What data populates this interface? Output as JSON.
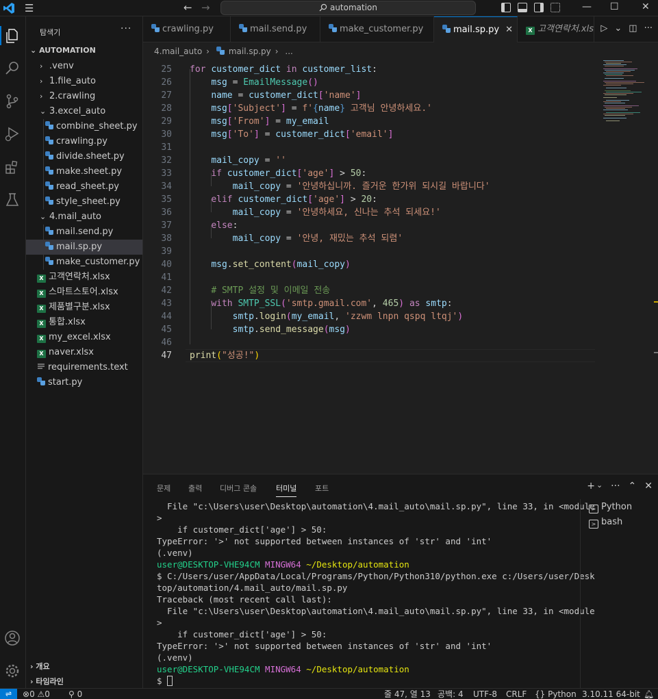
{
  "titlebar": {
    "search_text": "automation"
  },
  "sidebar": {
    "title": "탐색기",
    "root": "AUTOMATION",
    "items": [
      {
        "label": ".venv",
        "type": "folder",
        "open": false
      },
      {
        "label": "1.file_auto",
        "type": "folder",
        "open": false
      },
      {
        "label": "2.crawling",
        "type": "folder",
        "open": false
      },
      {
        "label": "3.excel_auto",
        "type": "folder",
        "open": true
      },
      {
        "label": "combine_sheet.py",
        "type": "py"
      },
      {
        "label": "crawling.py",
        "type": "py"
      },
      {
        "label": "divide.sheet.py",
        "type": "py"
      },
      {
        "label": "make.sheet.py",
        "type": "py"
      },
      {
        "label": "read_sheet.py",
        "type": "py"
      },
      {
        "label": "style_sheet.py",
        "type": "py"
      },
      {
        "label": "4.mail_auto",
        "type": "folder",
        "open": true
      },
      {
        "label": "mail.send.py",
        "type": "py"
      },
      {
        "label": "mail.sp.py",
        "type": "py"
      },
      {
        "label": "make_customer.py",
        "type": "py"
      },
      {
        "label": "고객연락처.xlsx",
        "type": "xlsx"
      },
      {
        "label": "스마트스토어.xlsx",
        "type": "xlsx"
      },
      {
        "label": "제품별구분.xlsx",
        "type": "xlsx"
      },
      {
        "label": "통합.xlsx",
        "type": "xlsx"
      },
      {
        "label": "my_excel.xlsx",
        "type": "xlsx"
      },
      {
        "label": "naver.xlsx",
        "type": "xlsx"
      },
      {
        "label": "requirements.text",
        "type": "txt"
      },
      {
        "label": "start.py",
        "type": "py"
      }
    ],
    "outline": "개요",
    "timeline": "타임라인"
  },
  "tabs": [
    {
      "label": "crawling.py"
    },
    {
      "label": "mail.send.py"
    },
    {
      "label": "make_customer.py"
    },
    {
      "label": "mail.sp.py"
    },
    {
      "label": "고객연락처.xlsx"
    }
  ],
  "breadcrumb": {
    "folder": "4.mail_auto",
    "file": "mail.sp.py",
    "more": "..."
  },
  "editor": {
    "line_numbers": [
      "25",
      "26",
      "27",
      "28",
      "29",
      "30",
      "31",
      "32",
      "33",
      "34",
      "35",
      "36",
      "37",
      "38",
      "39",
      "40",
      "41",
      "42",
      "43",
      "44",
      "45",
      "46",
      "47"
    ],
    "strings": {
      "s_name": "'name'",
      "s_subject": "'Subject'",
      "s_fstr_start": "f'",
      "s_fstr_end": " 고객님 안녕하세요.'",
      "s_from": "'From'",
      "s_to": "'To'",
      "s_email": "'email'",
      "s_empty": "''",
      "s_age": "'age'",
      "s_msg1": "'안녕하십니까. 즐거운 한가위 되시길 바랍니다'",
      "s_msg2": "'안녕하세요, 신나는 추석 되세요!'",
      "s_msg3": "'안녕, 재밌는 추석 되렴'",
      "s_comment": "# SMTP 설정 및 이메일 전송",
      "s_smtp": "'smtp.gmail.com'",
      "s_pass": "'zzwm lnpn qspq ltqj'",
      "s_success": "\"성공!\""
    },
    "numbers": {
      "n50": "50",
      "n20": "20",
      "n465": "465"
    }
  },
  "panel": {
    "tabs": [
      "문제",
      "출력",
      "디버그 콘솔",
      "터미널",
      "포트"
    ],
    "terminal_lines": [
      "  File \"c:\\Users\\user\\Desktop\\automation\\4.mail_auto\\mail.sp.py\", line 33, in <module",
      ">",
      "    if customer_dict['age'] > 50:",
      "TypeError: '>' not supported between instances of 'str' and 'int'",
      "(.venv)",
      "$ C:/Users/user/AppData/Local/Programs/Python/Python310/python.exe c:/Users/user/Desk",
      "top/automation/4.mail_auto/mail.sp.py",
      "Traceback (most recent call last):",
      "  File \"c:\\Users\\user\\Desktop\\automation\\4.mail_auto\\mail.sp.py\", line 33, in <module",
      ">",
      "    if customer_dict['age'] > 50:",
      "TypeError: '>' not supported between instances of 'str' and 'int'",
      "(.venv)",
      "$ "
    ],
    "prompt": {
      "user": "user@DESKTOP-VHE94CM",
      "shell": "MINGW64",
      "path": "~/Desktop/automation"
    },
    "terminals": [
      "Python",
      "bash"
    ]
  },
  "statusbar": {
    "errors": "0",
    "warnings": "0",
    "ports": "0",
    "position": "줄 47, 열 13",
    "spaces": "공백: 4",
    "encoding": "UTF-8",
    "eol": "CRLF",
    "language": "Python",
    "interpreter": "3.10.11 64-bit"
  }
}
